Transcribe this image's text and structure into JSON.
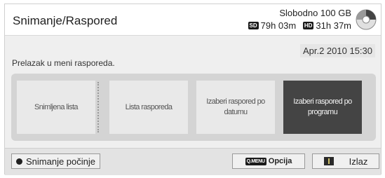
{
  "header": {
    "title": "Snimanje/Raspored",
    "free_space": "Slobodno 100 GB",
    "sd_badge": "SD",
    "sd_time": "79h 03m",
    "hd_badge": "HD",
    "hd_time": "31h 37m",
    "icon": "disc-icon"
  },
  "body": {
    "date": "Apr.2 2010 15:30",
    "description": "Prelazak u meni rasporeda.",
    "options": [
      {
        "label": "Snimljena lista",
        "selected": false
      },
      {
        "label": "Lista rasporeda",
        "selected": false
      },
      {
        "label": "Izaberi raspored po datumu",
        "selected": false
      },
      {
        "label": "Izaberi raspored po programu",
        "selected": true
      }
    ]
  },
  "footer": {
    "record_label": "Snimanje počinje",
    "qmenu_key": "Q.MENU",
    "option_label": "Opcija",
    "exit_label": "Izlaz"
  },
  "colors": {
    "selected_bg": "#444444",
    "option_bg": "#e9e9e9",
    "panel_bg": "#d4d4d4"
  }
}
